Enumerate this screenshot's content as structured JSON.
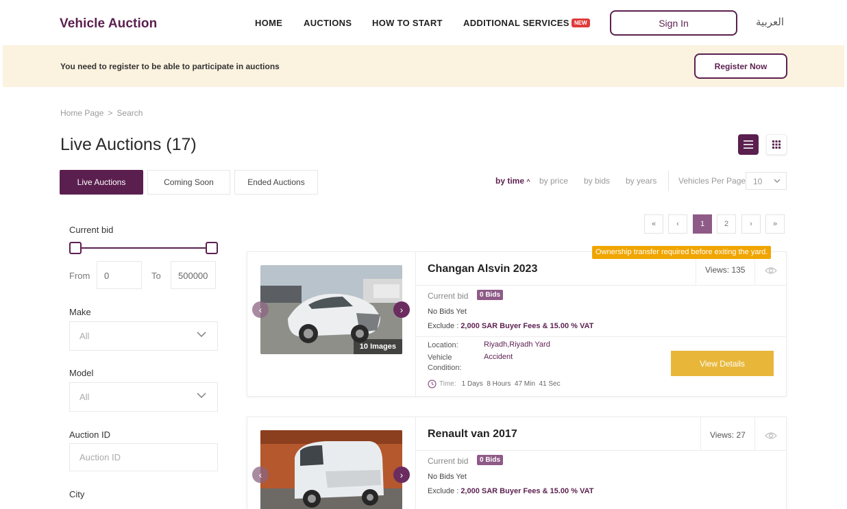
{
  "header": {
    "logo": "Vehicle Auction",
    "nav": [
      "HOME",
      "AUCTIONS",
      "HOW TO START",
      "ADDITIONAL SERVICES"
    ],
    "new_badge": "NEW",
    "sign_in": "Sign In",
    "language": "العربية"
  },
  "banner": {
    "text": "You need to register to be able to participate in auctions",
    "register": "Register Now"
  },
  "breadcrumb": {
    "home": "Home Page",
    "separator": ">",
    "current": "Search"
  },
  "page_title": "Live Auctions (17)",
  "tabs": [
    "Live Auctions",
    "Coming Soon",
    "Ended Auctions"
  ],
  "sort": {
    "options": [
      "by time",
      "by price",
      "by bids",
      "by years"
    ],
    "active": "by time",
    "per_page_label": "Vehicles Per Page",
    "per_page_value": "10"
  },
  "pagination": {
    "first": "«",
    "prev": "‹",
    "pages": [
      "1",
      "2"
    ],
    "current": "1",
    "next": "›",
    "last": "»"
  },
  "filters": {
    "current_bid_label": "Current bid",
    "from_label": "From",
    "from_value": "0",
    "to_label": "To",
    "to_value": "500000",
    "make_label": "Make",
    "make_value": "All",
    "model_label": "Model",
    "model_value": "All",
    "auction_id_label": "Auction ID",
    "auction_id_placeholder": "Auction ID",
    "city_label": "City"
  },
  "ownership_notice": "Ownership transfer required before exiting the yard.",
  "cards": [
    {
      "title": "Changan Alsvin 2023",
      "views": "Views: 135",
      "current_bid_label": "Current bid",
      "bids": "0 Bids",
      "no_bids": "No Bids Yet",
      "exclude_prefix": "Exclude : ",
      "exclude_fees": "2,000 SAR Buyer Fees & 15.00 % VAT",
      "images": "10 Images",
      "location_label": "Location:",
      "location": "Riyadh,Riyadh Yard",
      "condition_label_1": "Vehicle",
      "condition_label_2": "Condition:",
      "condition": "Accident",
      "time_label": "Time:",
      "time": "1 Days  8 Hours  47 Min  41 Sec",
      "button": "View Details"
    },
    {
      "title": "Renault van 2017",
      "views": "Views: 27",
      "current_bid_label": "Current bid",
      "bids": "0 Bids",
      "no_bids": "No Bids Yet",
      "exclude_prefix": "Exclude : ",
      "exclude_fees": "2,000 SAR Buyer Fees & 15.00 % VAT"
    }
  ],
  "colors": {
    "brand": "#5b1f4f",
    "accent": "#e8b73a",
    "notice": "#f0a500",
    "banner_bg": "#fbf2df"
  }
}
